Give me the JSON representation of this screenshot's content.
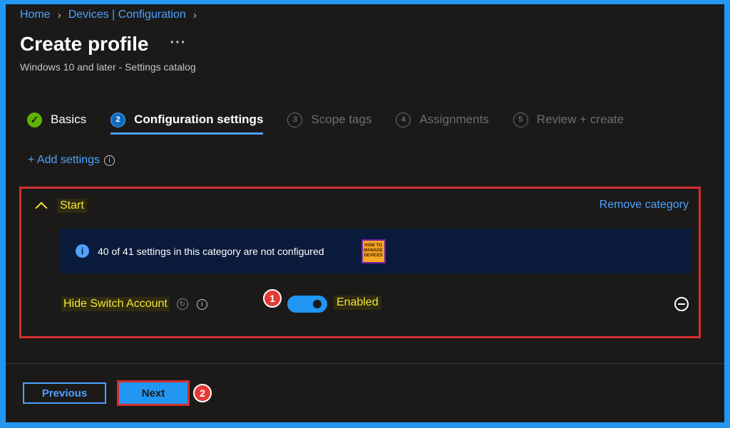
{
  "breadcrumb": {
    "home": "Home",
    "devices": "Devices | Configuration"
  },
  "page": {
    "title": "Create profile",
    "more": "···",
    "subtitle": "Windows 10 and later - Settings catalog"
  },
  "steps": [
    {
      "num": "✓",
      "label": "Basics",
      "state": "done"
    },
    {
      "num": "2",
      "label": "Configuration settings",
      "state": "active"
    },
    {
      "num": "3",
      "label": "Scope tags",
      "state": "pending"
    },
    {
      "num": "4",
      "label": "Assignments",
      "state": "pending"
    },
    {
      "num": "5",
      "label": "Review + create",
      "state": "pending"
    }
  ],
  "add_settings": {
    "label": "+ Add settings",
    "info": "i"
  },
  "category": {
    "title": "Start",
    "remove_label": "Remove category",
    "banner_icon": "i",
    "banner_text": "40 of 41 settings in this category are not configured",
    "logo_lines": [
      "HOW TO",
      "MANAGE",
      "DEVICES"
    ],
    "setting": {
      "label": "Hide Switch Account",
      "sync": "↻",
      "info": "i",
      "toggle_value": "Enabled",
      "toggle_on": true,
      "badge": "1"
    }
  },
  "footer": {
    "previous_label": "Previous",
    "next_label": "Next",
    "badge": "2"
  },
  "colors": {
    "accent": "#4ea1ff",
    "highlight": "#f5e53b",
    "annotation_red": "#d32f2f",
    "frame_blue": "#2196f3"
  }
}
